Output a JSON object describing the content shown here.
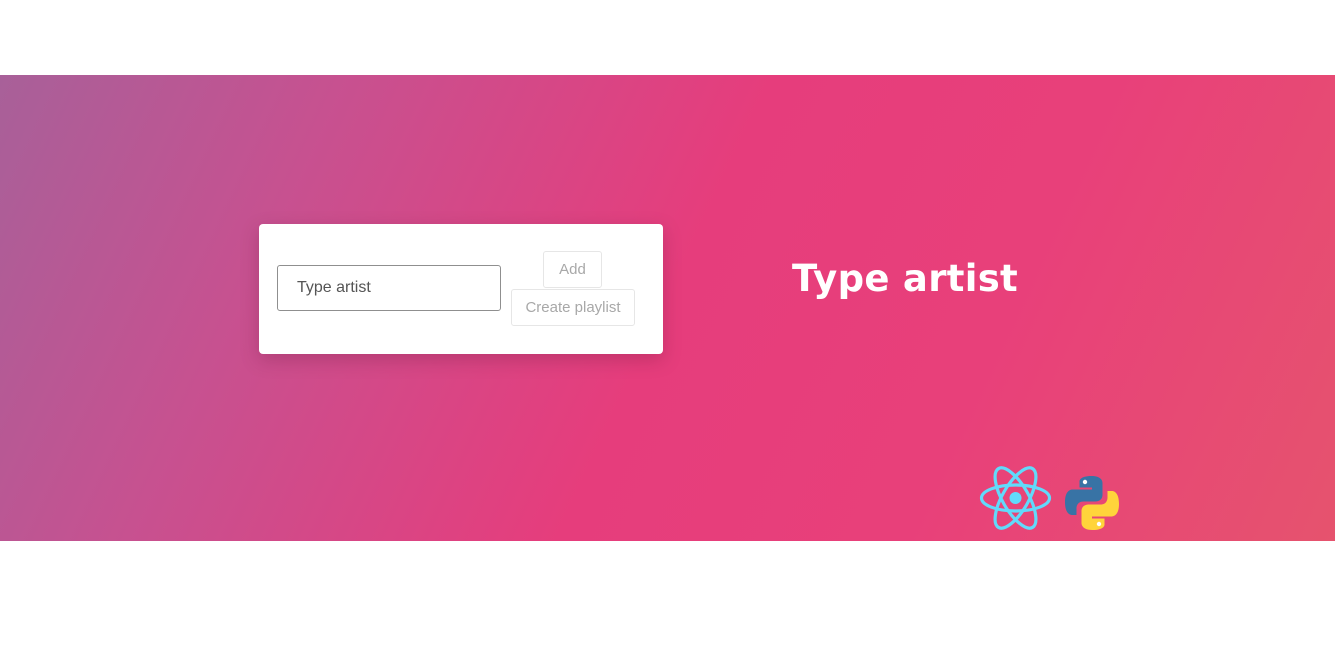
{
  "form": {
    "artist_input_value": "",
    "artist_input_placeholder": "Type artist",
    "add_label": "Add",
    "create_playlist_label": "Create playlist"
  },
  "headline": "Type artist",
  "icons": {
    "react": "react-logo-icon",
    "python": "python-logo-icon"
  },
  "colors": {
    "gradient_start": "#a86099",
    "gradient_mid": "#e63d7c",
    "gradient_end": "#e6536e",
    "react_blue": "#61dafb",
    "python_blue": "#3873a5",
    "python_yellow": "#ffd43b"
  }
}
